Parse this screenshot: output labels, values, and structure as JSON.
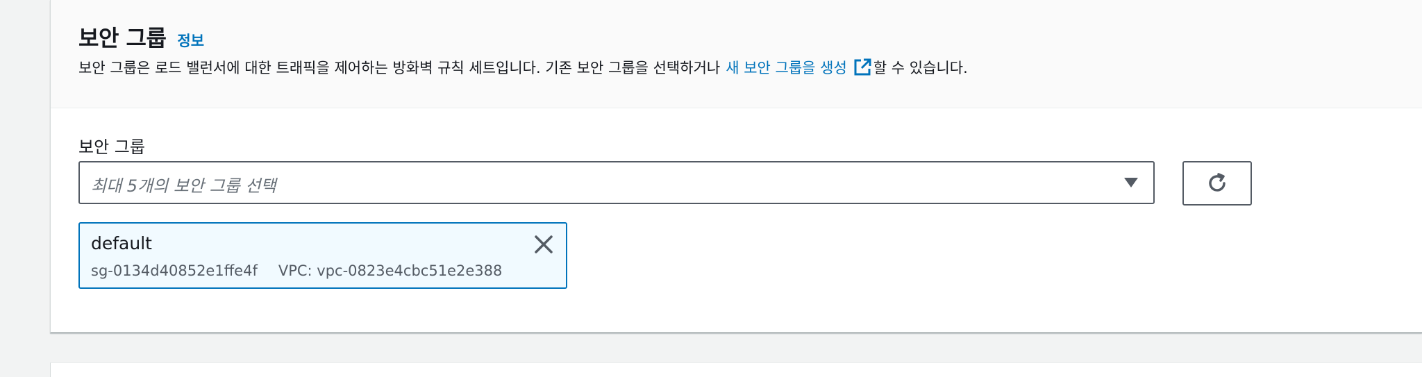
{
  "section": {
    "title": "보안 그룹",
    "info_link": "정보",
    "description_before": "보안 그룹은 로드 밸런서에 대한 트래픽을 제어하는 방화벽 규칙 세트입니다. 기존 보안 그룹을 선택하거나",
    "description_link": "새 보안 그룹을 생성",
    "description_after": "할 수 있습니다."
  },
  "field": {
    "label": "보안 그룹",
    "placeholder": "최대 5개의 보안 그룹 선택"
  },
  "selected_groups": [
    {
      "name": "default",
      "id": "sg-0134d40852e1ffe4f",
      "vpc": "VPC: vpc-0823e4cbc51e2e388"
    }
  ],
  "icons": {
    "external": "external-link-icon",
    "caret": "caret-down-icon",
    "refresh": "refresh-icon",
    "close": "close-icon"
  },
  "colors": {
    "link": "#0073bb",
    "token_border": "#0073bb",
    "token_bg": "#f1faff",
    "text": "#16191f",
    "muted": "#545b64"
  }
}
